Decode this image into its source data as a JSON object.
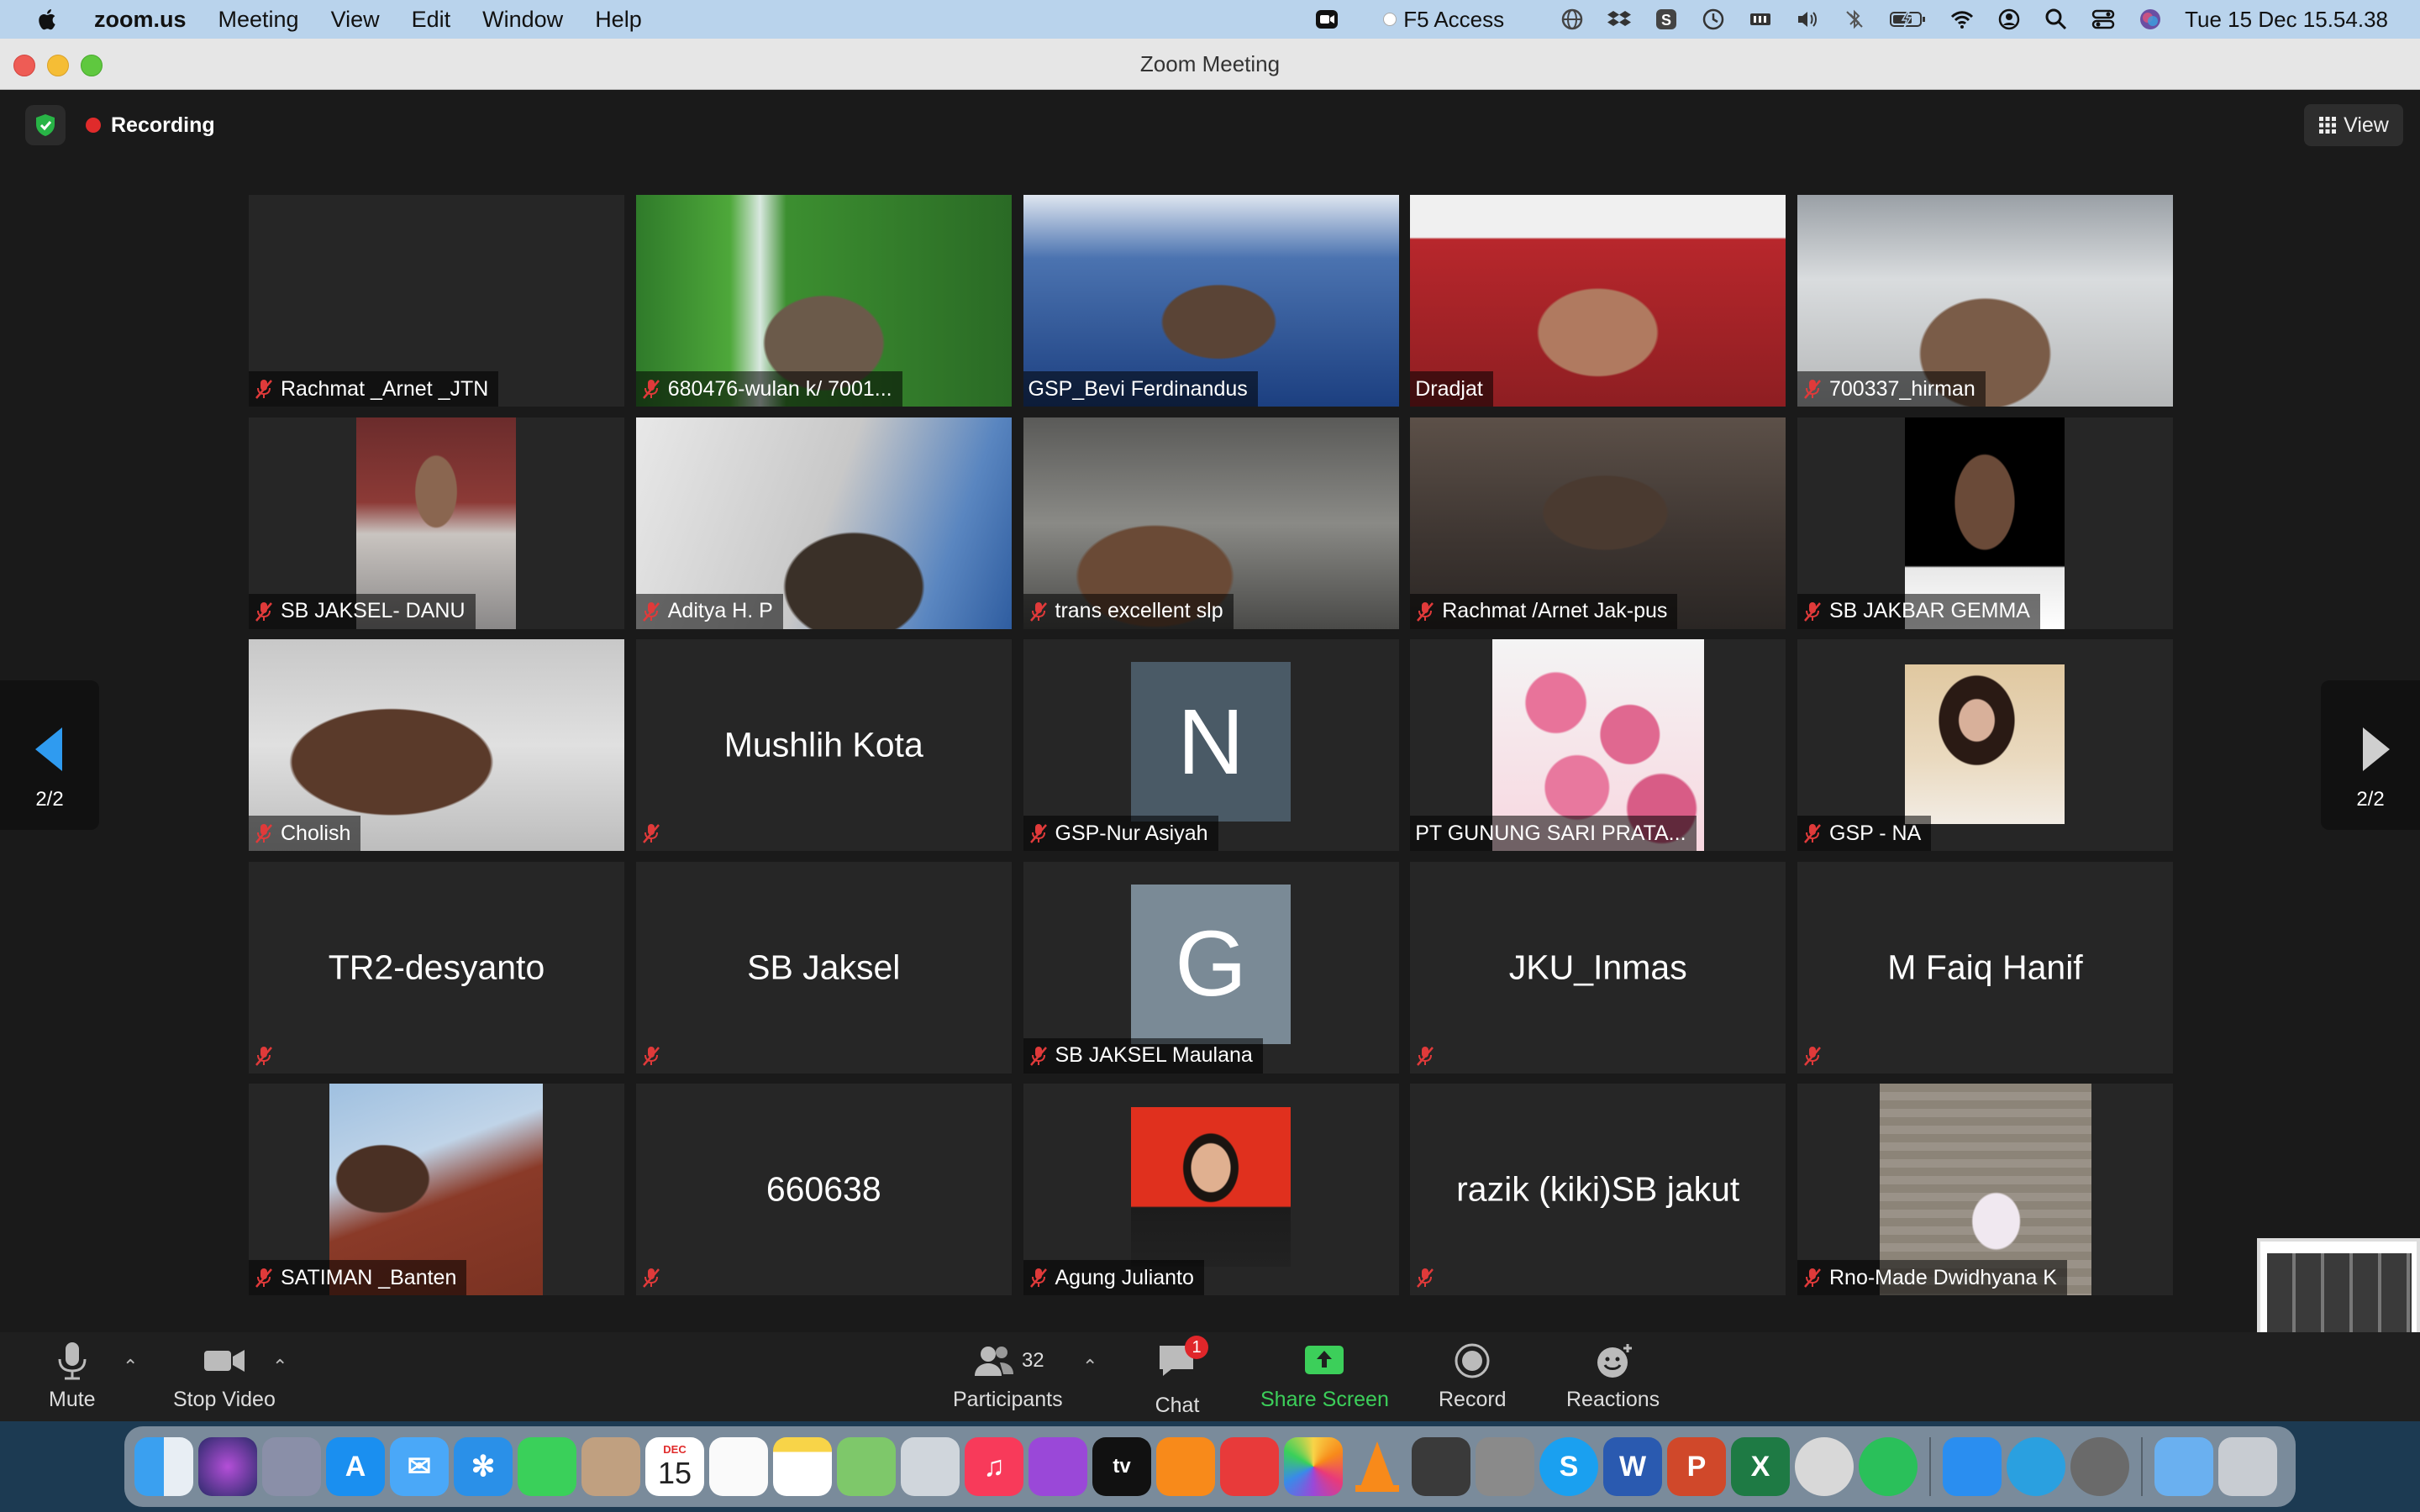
{
  "menubar": {
    "app": "zoom.us",
    "items": [
      "Meeting",
      "View",
      "Edit",
      "Window",
      "Help"
    ],
    "f5_label": "F5 Access",
    "clock": "Tue 15 Dec  15.54.38"
  },
  "window": {
    "title": "Zoom Meeting"
  },
  "meeting": {
    "recording_label": "Recording",
    "view_label": "View",
    "page_indicator_left": "2/2",
    "page_indicator_right": "2/2"
  },
  "tiles": [
    {
      "name": "Rachmat _Arnet _JTN"
    },
    {
      "name": "680476-wulan k/ 7001..."
    },
    {
      "name": "GSP_Bevi Ferdinandus"
    },
    {
      "name": "Dradjat"
    },
    {
      "name": "700337_hirman"
    },
    {
      "name": "SB JAKSEL- DANU"
    },
    {
      "name": "Aditya H. P"
    },
    {
      "name": "trans excellent slp"
    },
    {
      "name": "Rachmat /Arnet Jak-pus"
    },
    {
      "name": "SB JAKBAR GEMMA"
    },
    {
      "name": "Cholish"
    },
    {
      "name": "Mushlih Kota"
    },
    {
      "name": "GSP-Nur Asiyah",
      "letter": "N"
    },
    {
      "name": "PT GUNUNG SARI PRATA..."
    },
    {
      "name": "GSP - NA"
    },
    {
      "name": "TR2-desyanto"
    },
    {
      "name": "SB Jaksel"
    },
    {
      "name": "SB JAKSEL Maulana",
      "letter": "G"
    },
    {
      "name": "JKU_Inmas"
    },
    {
      "name": "M Faiq Hanif"
    },
    {
      "name": "SATIMAN _Banten"
    },
    {
      "name": "660638"
    },
    {
      "name": "Agung Julianto"
    },
    {
      "name": "razik (kiki)SB jakut"
    },
    {
      "name": "Rno-Made Dwidhyana K"
    }
  ],
  "toolbar": {
    "mute": "Mute",
    "stop_video": "Stop Video",
    "participants": "Participants",
    "participants_count": "32",
    "chat": "Chat",
    "chat_badge": "1",
    "share_screen": "Share Screen",
    "record": "Record",
    "reactions": "Reactions"
  },
  "dock": {
    "calendar_month": "DEC",
    "calendar_day": "15"
  },
  "colors": {
    "share_green": "#3ccf5a",
    "recording_red": "#e02b2b",
    "muted_red": "#e03a3a"
  }
}
